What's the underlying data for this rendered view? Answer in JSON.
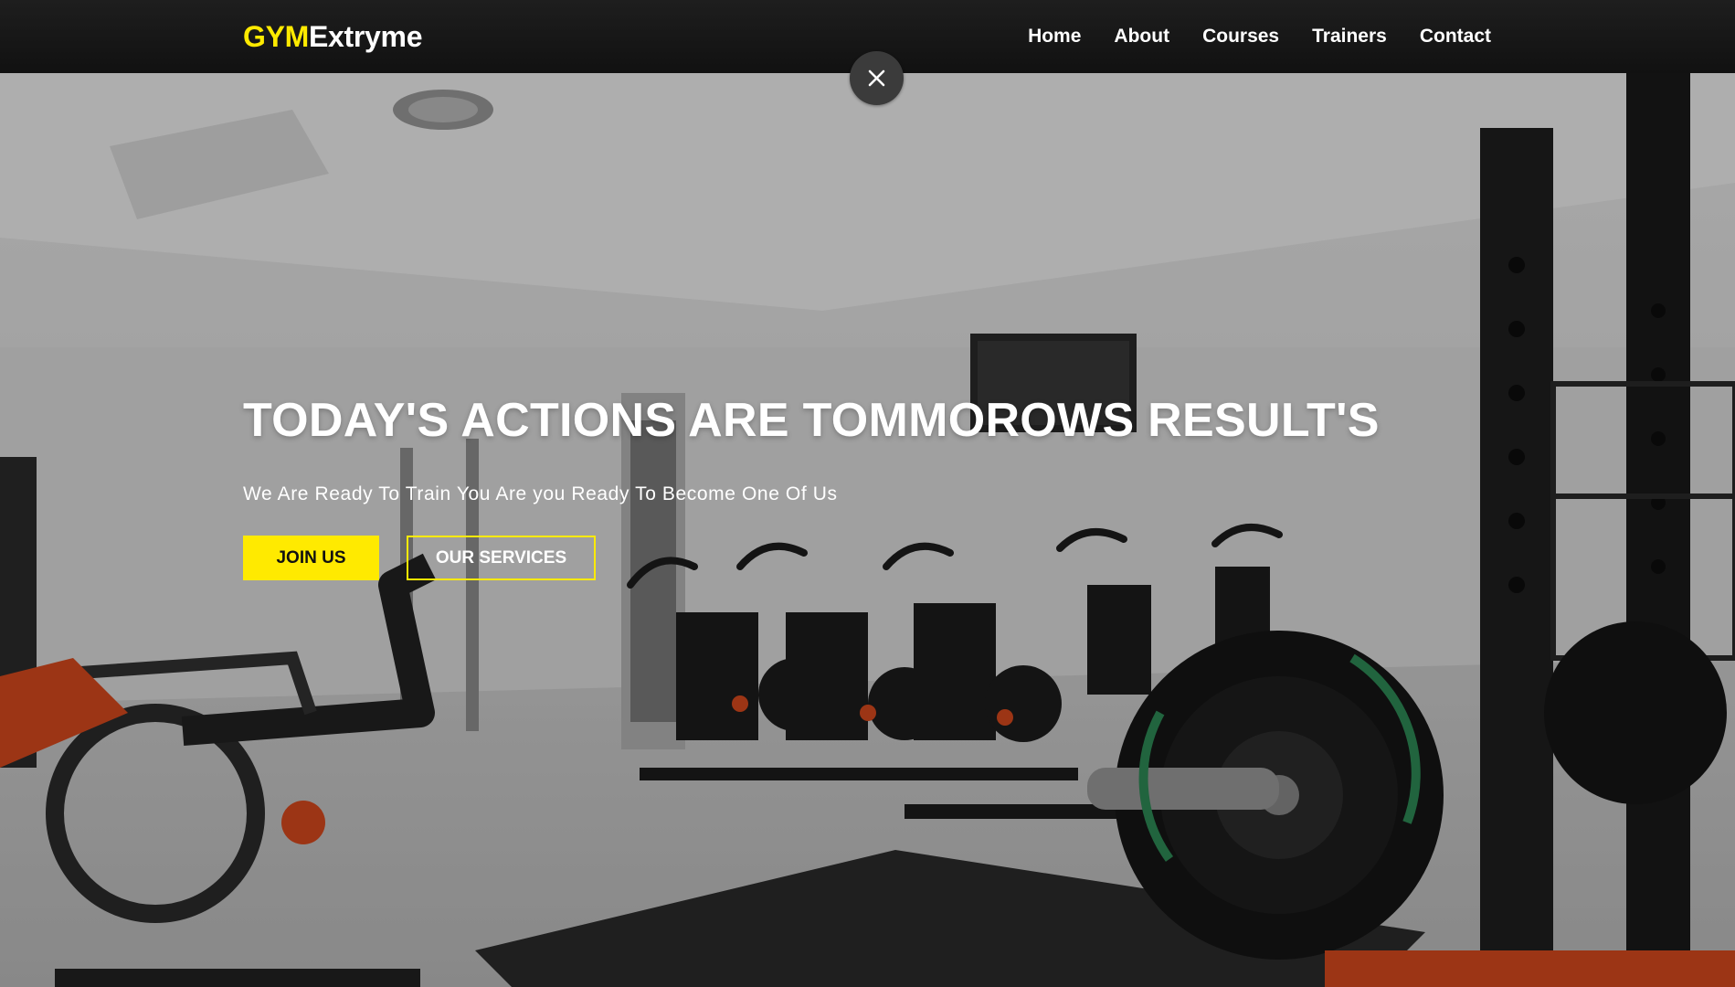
{
  "brand": {
    "part1": "GYM",
    "part2": "Extryme"
  },
  "nav": {
    "items": [
      {
        "label": "Home"
      },
      {
        "label": "About"
      },
      {
        "label": "Courses"
      },
      {
        "label": "Trainers"
      },
      {
        "label": "Contact"
      }
    ]
  },
  "close_icon": "close-icon",
  "hero": {
    "headline": "TODAY'S ACTIONS ARE TOMMOROWS RESULT'S",
    "subline": "We Are Ready To Train You Are you Ready To Become One Of Us",
    "primary_button": "JOIN US",
    "secondary_button": "OUR SERVICES",
    "background_image": "gym-interior-photo"
  },
  "colors": {
    "accent": "#ffea00",
    "navbar": "#151515",
    "text": "#ffffff",
    "close_button": "#3b3b3b"
  }
}
